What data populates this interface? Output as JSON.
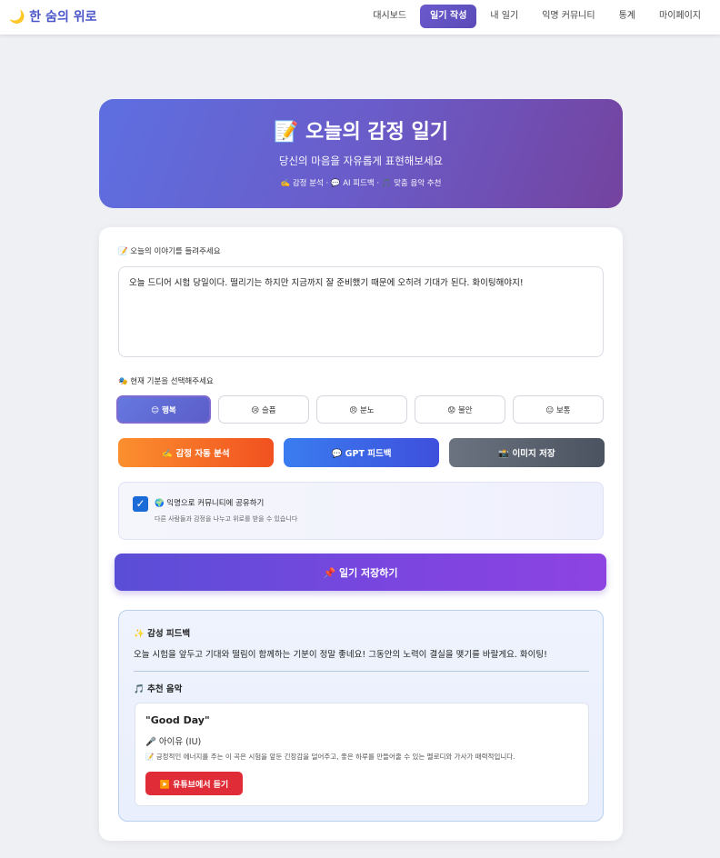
{
  "brand": {
    "icon": "moon-icon",
    "title": "🌙 한 숨의 위로"
  },
  "nav": {
    "items": [
      "대시보드",
      "일기 작성",
      "내 일기",
      "익명 커뮤니티",
      "통계",
      "마이페이지"
    ],
    "active_index": 1
  },
  "hero": {
    "title": "📝 오늘의 감정 일기",
    "subtitle": "당신의 마음을 자유롭게 표현해보세요",
    "tags": "✍️ 감정 분석 · 💬 AI 피드백 · 🎵 맞춤 음악 추천"
  },
  "form": {
    "diary_label": "📝 오늘의 이야기를 들려주세요",
    "diary_value": "오늘 드디어 시험 당일이다. 떨리기는 하지만 지금까지 잘 준비했기 때문에 오히려 기대가 된다. 화이팅해야지!",
    "mood_label": "🎭 현재 기분을 선택해주세요",
    "moods": [
      "😊 행복",
      "😢 슬픔",
      "😠 분노",
      "😟 불안",
      "😐 보통"
    ],
    "selected_mood": "😊 행복",
    "actions": {
      "analyze": "✍️ 감정 자동 분석",
      "gpt": "💬 GPT 피드백",
      "image": "📸 이미지 저장"
    },
    "share": {
      "checked": true,
      "title": "🌍 익명으로 커뮤니티에 공유하기",
      "subtitle": "다른 사람들과 감정을 나누고 위로를 받을 수 있습니다"
    },
    "save_label": "📌 일기 저장하기"
  },
  "feedback": {
    "title": "✨ 감성 피드백",
    "text": "오늘 시험을 앞두고 기대와 떨림이 함께하는 기분이 정말 좋네요! 그동안의 노력이 결실을 맺기를 바랄게요. 화이팅!",
    "music_title": "🎵 추천 음악",
    "song": "\"Good Day\"",
    "artist": "🎤 아이유 (IU)",
    "description": "📝 긍정적인 에너지를 주는 이 곡은 시험을 앞둔 긴장감을 덜어주고, 좋은 하루를 만들어줄 수 있는 멜로디와 가사가 매력적입니다.",
    "youtube_label": "▶️ 유튜브에서 듣기"
  },
  "colors": {
    "brand": "#4a56c8",
    "hero_start": "#5e6fe0",
    "hero_end": "#74439f",
    "youtube": "#e02c36"
  }
}
